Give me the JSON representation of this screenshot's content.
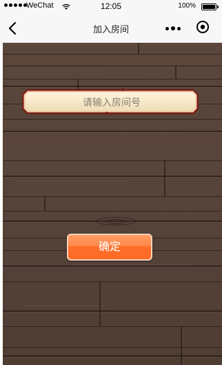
{
  "status_bar": {
    "carrier": "WeChat",
    "time": "12:05",
    "battery_percent": "100%"
  },
  "nav": {
    "title": "加入房间"
  },
  "form": {
    "room_input_placeholder": "请输入房间号",
    "room_input_value": "",
    "confirm_label": "确定"
  },
  "colors": {
    "wood": "#56433a",
    "input_plate": "#f5e6c6",
    "input_border": "#7a1e16",
    "confirm": "#ff7a36"
  }
}
